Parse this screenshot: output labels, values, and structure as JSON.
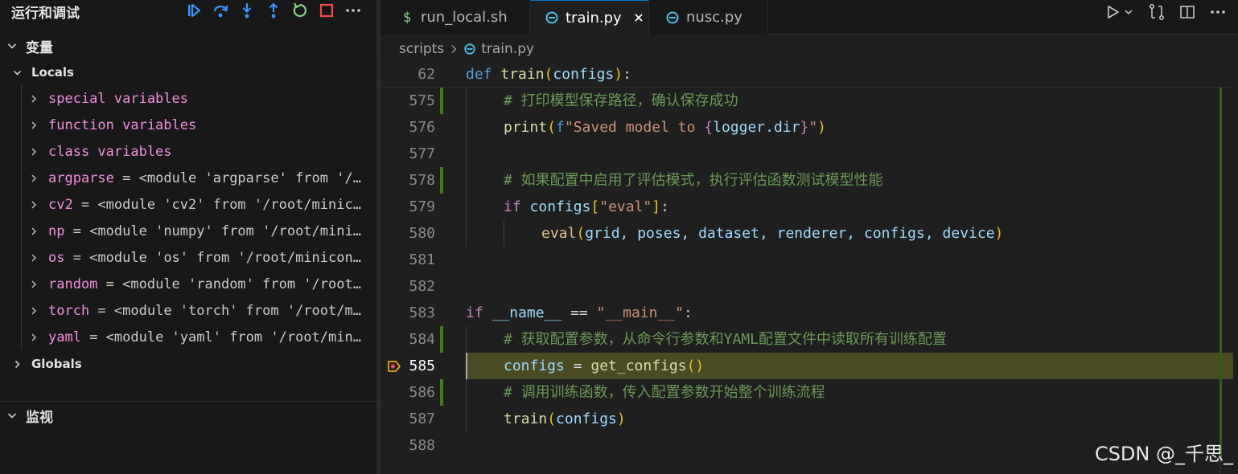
{
  "sidebar": {
    "title": "运行和调试",
    "toolbar": [
      {
        "name": "continue"
      },
      {
        "name": "step-over"
      },
      {
        "name": "step-into"
      },
      {
        "name": "step-out"
      },
      {
        "name": "restart"
      },
      {
        "name": "stop"
      },
      {
        "name": "more"
      }
    ],
    "variables_label": "变量",
    "locals_label": "Locals",
    "locals": [
      {
        "name": "special variables",
        "value": ""
      },
      {
        "name": "function variables",
        "value": ""
      },
      {
        "name": "class variables",
        "value": ""
      },
      {
        "name": "argparse",
        "value": "<module 'argparse' from '/…"
      },
      {
        "name": "cv2",
        "value": "<module 'cv2' from '/root/minic…"
      },
      {
        "name": "np",
        "value": "<module 'numpy' from '/root/mini…"
      },
      {
        "name": "os",
        "value": "<module 'os' from '/root/minicon…"
      },
      {
        "name": "random",
        "value": "<module 'random' from '/root…"
      },
      {
        "name": "torch",
        "value": "<module 'torch' from '/root/m…"
      },
      {
        "name": "yaml",
        "value": "<module 'yaml' from '/root/min…"
      }
    ],
    "globals_label": "Globals",
    "watch_label": "监视"
  },
  "tabs": [
    {
      "label": "run_local.sh",
      "icon": "shell-icon",
      "active": false
    },
    {
      "label": "train.py",
      "icon": "python-icon",
      "active": true
    },
    {
      "label": "nusc.py",
      "icon": "python-icon",
      "active": false
    }
  ],
  "breadcrumb": {
    "folder": "scripts",
    "file": "train.py"
  },
  "editor": {
    "current_line": 585,
    "lines": [
      {
        "n": "62",
        "sticky": true
      },
      {
        "n": "575"
      },
      {
        "n": "576"
      },
      {
        "n": "577"
      },
      {
        "n": "578"
      },
      {
        "n": "579"
      },
      {
        "n": "580"
      },
      {
        "n": "581"
      },
      {
        "n": "582"
      },
      {
        "n": "583"
      },
      {
        "n": "584"
      },
      {
        "n": "585"
      },
      {
        "n": "586"
      },
      {
        "n": "587"
      },
      {
        "n": "588"
      }
    ],
    "code": {
      "l62_def": "def",
      "l62_fn": "train",
      "l62_arg": "configs",
      "l575": "# 打印模型保存路径，确认保存成功",
      "l576_fn": "print",
      "l576_f": "f",
      "l576_str1": "\"Saved model to ",
      "l576_expr": "logger.dir",
      "l576_str2": "\"",
      "l578": "# 如果配置中启用了评估模式，执行评估函数测试模型性能",
      "l579_if": "if",
      "l579_var": "configs",
      "l579_key": "\"eval\"",
      "l580_fn": "eval",
      "l580_args": "grid, poses, dataset, renderer, configs, device",
      "l583_if": "if",
      "l583_name": "__name__",
      "l583_eq": " == ",
      "l583_str": "\"__main__\"",
      "l584": "# 获取配置参数，从命令行参数和YAML配置文件中读取所有训练配置",
      "l585_var": "configs",
      "l585_eq": " = ",
      "l585_fn": "get_configs",
      "l586": "# 调用训练函数，传入配置参数开始整个训练流程",
      "l587_fn": "train",
      "l587_arg": "configs"
    }
  },
  "watermark": "CSDN @_千思_",
  "colors": {
    "accent": "#0078d4",
    "current_line_bg": "#4a4a23",
    "modified_gutter": "#3f7f1f",
    "breakpoint": "#e8a317"
  }
}
